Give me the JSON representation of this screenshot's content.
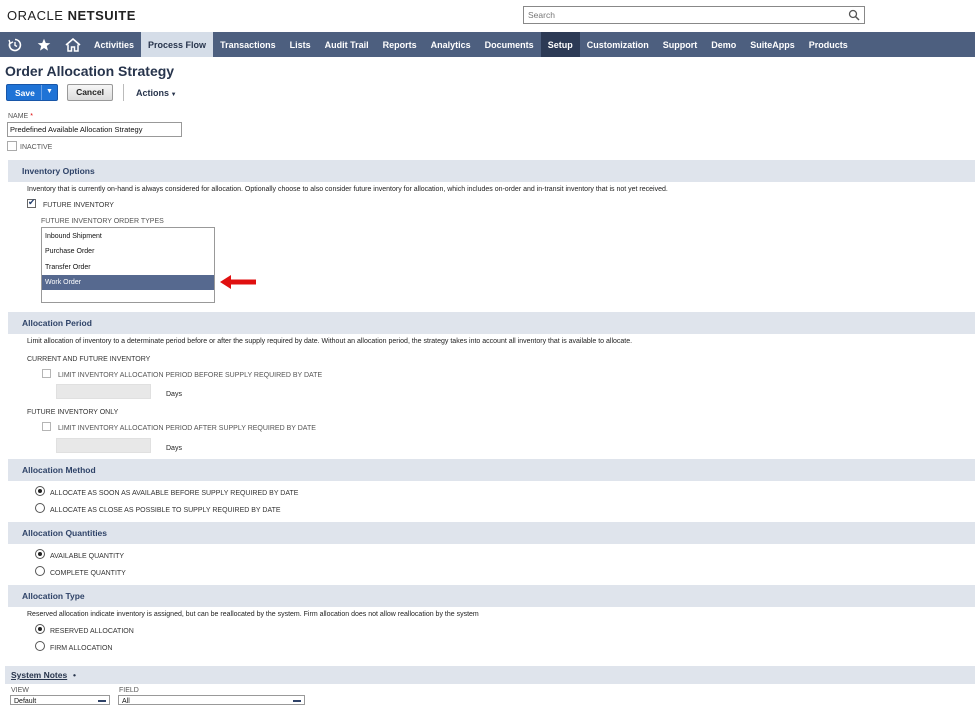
{
  "app": {
    "brand_prefix": "ORACLE",
    "brand_suffix": "NETSUITE"
  },
  "search": {
    "placeholder": "Search"
  },
  "nav": {
    "items": [
      "Activities",
      "Process Flow",
      "Transactions",
      "Lists",
      "Audit Trail",
      "Reports",
      "Analytics",
      "Documents",
      "Setup",
      "Customization",
      "Support",
      "Demo",
      "SuiteApps",
      "Products"
    ],
    "active": "Process Flow",
    "highlighted": "Setup",
    "icons": [
      "recent-icon",
      "star-icon",
      "home-icon"
    ]
  },
  "page": {
    "title": "Order Allocation Strategy"
  },
  "toolbar": {
    "save": "Save",
    "cancel": "Cancel",
    "actions": "Actions"
  },
  "form": {
    "name_label": "NAME",
    "name_required_mark": "*",
    "name_value": "Predefined Available Allocation Strategy",
    "inactive_label": "INACTIVE",
    "inactive_checked": false
  },
  "inventory_options": {
    "title": "Inventory Options",
    "description": "Inventory that is currently on-hand is always considered for allocation. Optionally choose to also consider future inventory for allocation, which includes on-order and in-transit inventory that is not yet received.",
    "future_inventory_label": "FUTURE INVENTORY",
    "future_inventory_checked": true,
    "order_types_label": "FUTURE INVENTORY ORDER TYPES",
    "order_types": [
      "Inbound Shipment",
      "Purchase Order",
      "Transfer Order",
      "Work Order"
    ],
    "selected_order_type": "Work Order"
  },
  "allocation_period": {
    "title": "Allocation Period",
    "description": "Limit allocation of inventory to a determinate period before or after the supply required by date. Without an allocation period, the strategy takes into account all inventory that is available to allocate.",
    "current_future_label": "CURRENT AND FUTURE INVENTORY",
    "limit_before_label": "LIMIT INVENTORY ALLOCATION PERIOD BEFORE SUPPLY REQUIRED BY DATE",
    "days_label_1": "Days",
    "future_only_label": "FUTURE INVENTORY ONLY",
    "limit_after_label": "LIMIT INVENTORY ALLOCATION PERIOD AFTER SUPPLY REQUIRED BY DATE",
    "days_label_2": "Days"
  },
  "allocation_method": {
    "title": "Allocation Method",
    "options": [
      "ALLOCATE AS SOON AS AVAILABLE BEFORE SUPPLY REQUIRED BY DATE",
      "ALLOCATE AS CLOSE AS POSSIBLE TO SUPPLY REQUIRED BY DATE"
    ],
    "selected_index": 0
  },
  "allocation_quantities": {
    "title": "Allocation Quantities",
    "options": [
      "AVAILABLE QUANTITY",
      "COMPLETE QUANTITY"
    ],
    "selected_index": 0
  },
  "allocation_type": {
    "title": "Allocation Type",
    "description": "Reserved allocation indicate inventory is assigned, but can be reallocated by the system. Firm allocation does not allow reallocation by the system",
    "options": [
      "RESERVED ALLOCATION",
      "FIRM ALLOCATION"
    ],
    "selected_index": 0
  },
  "system_notes": {
    "title": "System Notes",
    "view_label": "VIEW",
    "view_value": "Default",
    "field_label": "FIELD",
    "field_value": "All"
  },
  "colors": {
    "nav_bg": "#4d5f7f",
    "section_bg": "#dfe4ec",
    "save_btn": "#1f73d6",
    "selected_row": "#56698f",
    "annotation_arrow": "#e01010"
  }
}
